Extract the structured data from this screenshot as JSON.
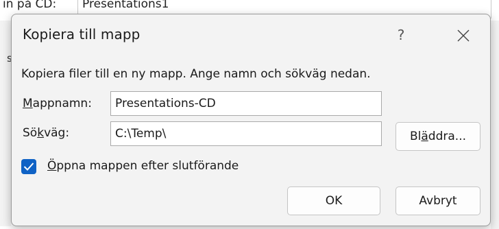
{
  "background": {
    "label": "ın på CD:",
    "field_value": "Presentations1",
    "side_char": "s"
  },
  "dialog": {
    "title": "Kopiera till mapp",
    "help_label": "?",
    "instruction": "Kopiera filer till en ny mapp. Ange namn och sökväg nedan.",
    "folder_name": {
      "label_pre": "",
      "label_access": "M",
      "label_post": "appnamn:",
      "value": "Presentations-CD"
    },
    "path": {
      "label_pre": "Sö",
      "label_access": "k",
      "label_post": "väg:",
      "value": "C:\\Temp\\"
    },
    "browse_button": {
      "label_pre": "Bl",
      "label_access": "ä",
      "label_post": "ddra..."
    },
    "open_folder_checkbox": {
      "checked": true,
      "label_pre": "",
      "label_access": "Ö",
      "label_post": "ppna mappen efter slutförande"
    },
    "ok_label": "OK",
    "cancel_label": "Avbryt"
  },
  "colors": {
    "accent": "#0f62c5",
    "dialog_bg": "#f3f3f3"
  },
  "icons": {
    "close": "close-icon",
    "check": "checkmark-icon"
  }
}
